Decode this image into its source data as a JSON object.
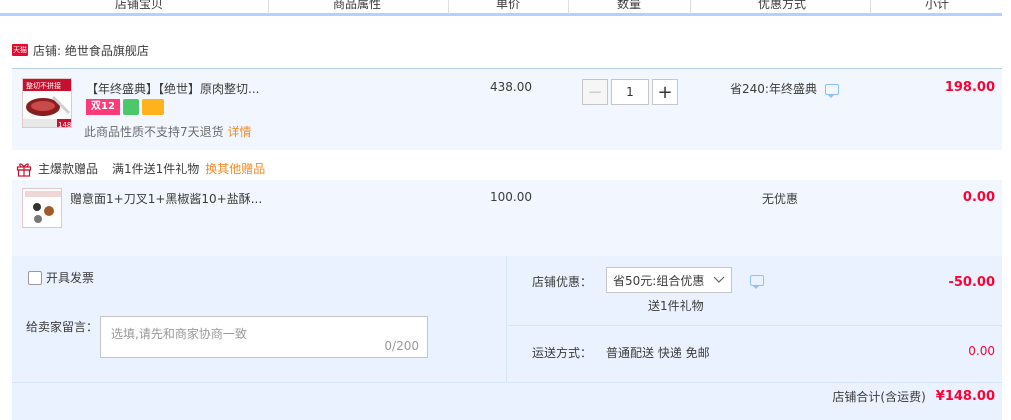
{
  "header": {
    "cols": [
      "店铺宝贝",
      "商品属性",
      "单价",
      "数量",
      "优惠方式",
      "小计"
    ]
  },
  "shop": {
    "badge": "天猫",
    "name": "店铺: 绝世食品旗舰店"
  },
  "item": {
    "thumb_text": "整切不拼接",
    "thumb_price": "148",
    "title": "【年终盛典】【绝世】原肉整切...",
    "badge_double12": "双12",
    "policy": "此商品性质不支持7天退货",
    "policy_link": "详情",
    "price": "438.00",
    "qty": "1",
    "minus": "−",
    "plus": "+",
    "discount": "省240:年终盛典",
    "subtotal": "198.00"
  },
  "giftbar": {
    "label": "主爆款赠品",
    "rule": "满1件送1件礼物",
    "link": "换其他赠品"
  },
  "gift": {
    "title": "赠意面1+刀叉1+黑椒酱10+盐酥...",
    "price": "100.00",
    "discount": "无优惠",
    "subtotal": "0.00"
  },
  "order": {
    "invoice_label": "开具发票",
    "message_label": "给卖家留言：",
    "message_placeholder": "选填,请先和商家协商一致",
    "message_count": "0/200",
    "coupon_label": "店铺优惠：",
    "coupon_value": "省50元:组合优惠",
    "coupon_gift": "送1件礼物",
    "coupon_amount": "-50.00",
    "shipping_label": "运送方式：",
    "shipping_value": "普通配送 快递 免邮",
    "shipping_amount": "0.00",
    "total_label": "店铺合计(含运费)",
    "total_amount": "¥148.00"
  }
}
